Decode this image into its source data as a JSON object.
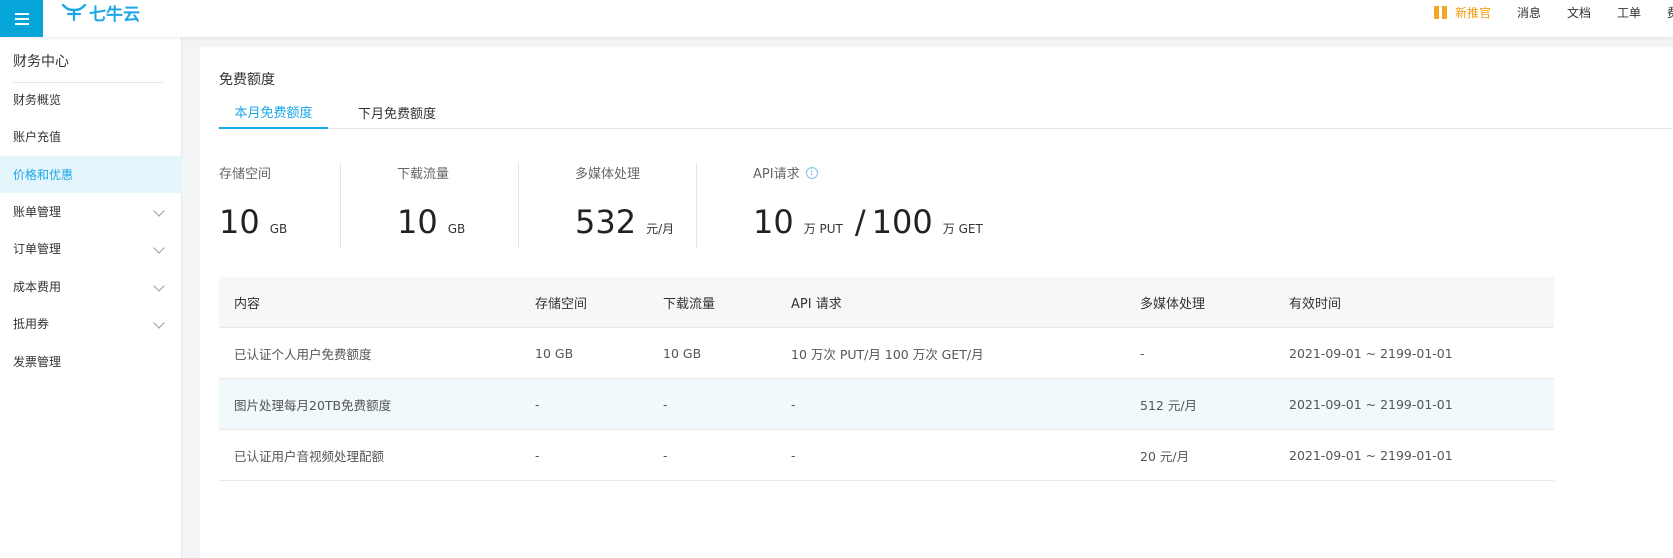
{
  "header": {
    "logo_text": "七牛云",
    "nav": {
      "promo": "新推官",
      "messages": "消息",
      "docs": "文档",
      "tickets": "工单",
      "billing": "费"
    }
  },
  "sidebar": {
    "title": "财务中心",
    "items": [
      {
        "label": "财务概览",
        "expandable": false,
        "active": false
      },
      {
        "label": "账户充值",
        "expandable": false,
        "active": false
      },
      {
        "label": "价格和优惠",
        "expandable": false,
        "active": true
      },
      {
        "label": "账单管理",
        "expandable": true,
        "active": false
      },
      {
        "label": "订单管理",
        "expandable": true,
        "active": false
      },
      {
        "label": "成本费用",
        "expandable": true,
        "active": false
      },
      {
        "label": "抵用券",
        "expandable": true,
        "active": false
      },
      {
        "label": "发票管理",
        "expandable": false,
        "active": false
      }
    ]
  },
  "main": {
    "title": "免费额度",
    "tabs": [
      {
        "label": "本月免费额度",
        "active": true
      },
      {
        "label": "下月免费额度",
        "active": false
      }
    ],
    "stats": {
      "storage": {
        "label": "存储空间",
        "value": "10",
        "unit": "GB"
      },
      "download": {
        "label": "下载流量",
        "value": "10",
        "unit": "GB"
      },
      "media": {
        "label": "多媒体处理",
        "value": "532",
        "unit": "元/月"
      },
      "api": {
        "label": "API请求",
        "put_value": "10",
        "put_unit": "万 PUT",
        "slash": "/",
        "get_value": "100",
        "get_unit": "万 GET"
      }
    },
    "table": {
      "columns": [
        "内容",
        "存储空间",
        "下载流量",
        "API 请求",
        "多媒体处理",
        "有效时间"
      ],
      "rows": [
        [
          "已认证个人用户免费额度",
          "10 GB",
          "10 GB",
          "10 万次 PUT/月 100 万次 GET/月",
          "-",
          "2021-09-01 ~ 2199-01-01"
        ],
        [
          "图片处理每月20TB免费额度",
          "-",
          "-",
          "-",
          "512 元/月",
          "2021-09-01 ~ 2199-01-01"
        ],
        [
          "已认证用户音视频处理配额",
          "-",
          "-",
          "-",
          "20 元/月",
          "2021-09-01 ~ 2199-01-01"
        ]
      ]
    }
  },
  "colors": {
    "accent": "#1aa7e8",
    "menu_button": "#06a5d9",
    "promo": "#f59a0a"
  }
}
